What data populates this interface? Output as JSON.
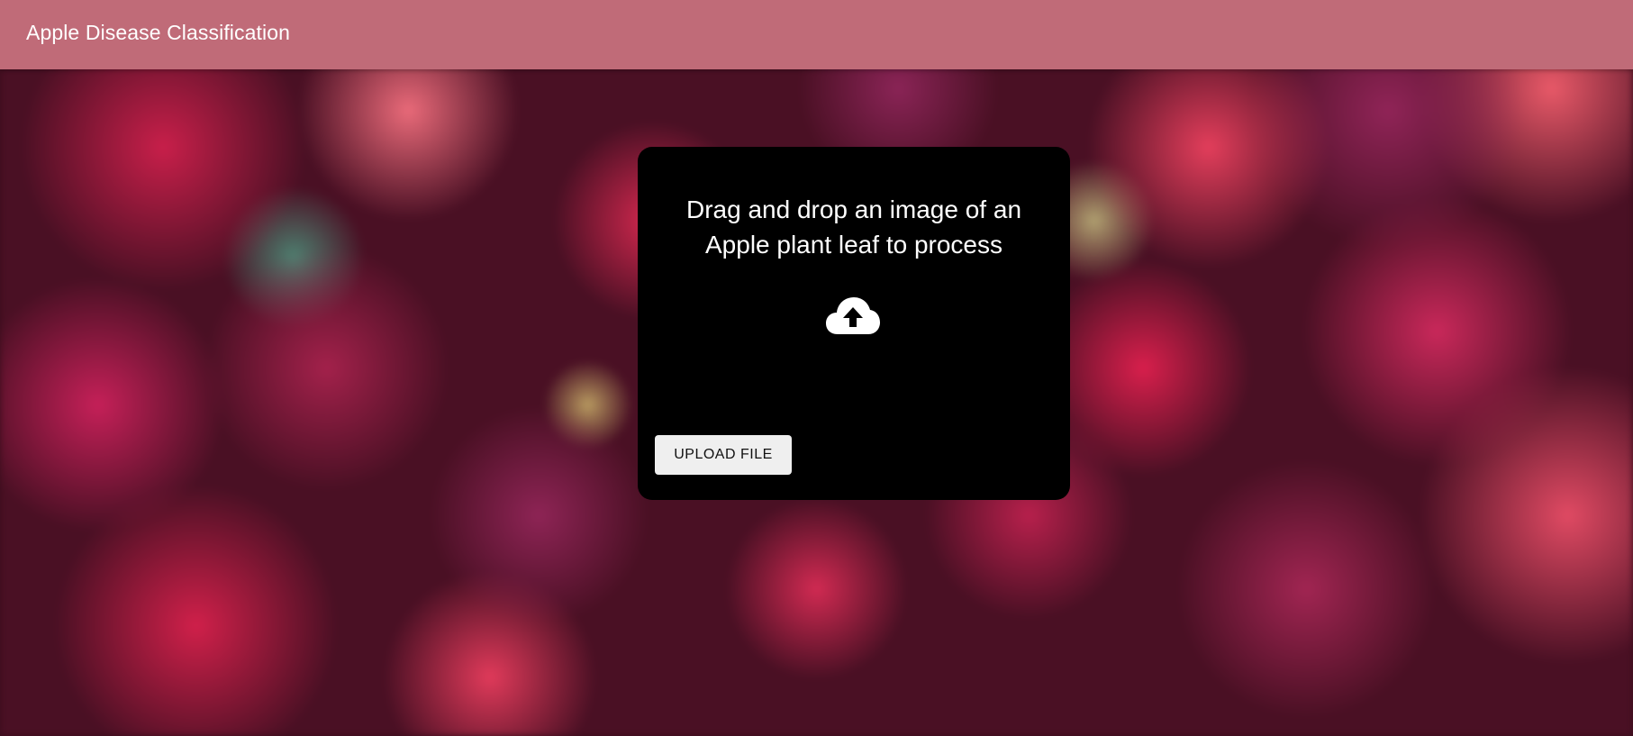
{
  "header": {
    "title": "Apple Disease Classification",
    "background_color": "#c06b78"
  },
  "dropzone": {
    "instructions": "Drag and drop an image of an Apple plant leaf to process",
    "icon": "cloud-upload-icon",
    "upload_button_label": "UPLOAD FILE",
    "background_color": "#000000"
  },
  "background": {
    "theme": "blurred red apples"
  }
}
